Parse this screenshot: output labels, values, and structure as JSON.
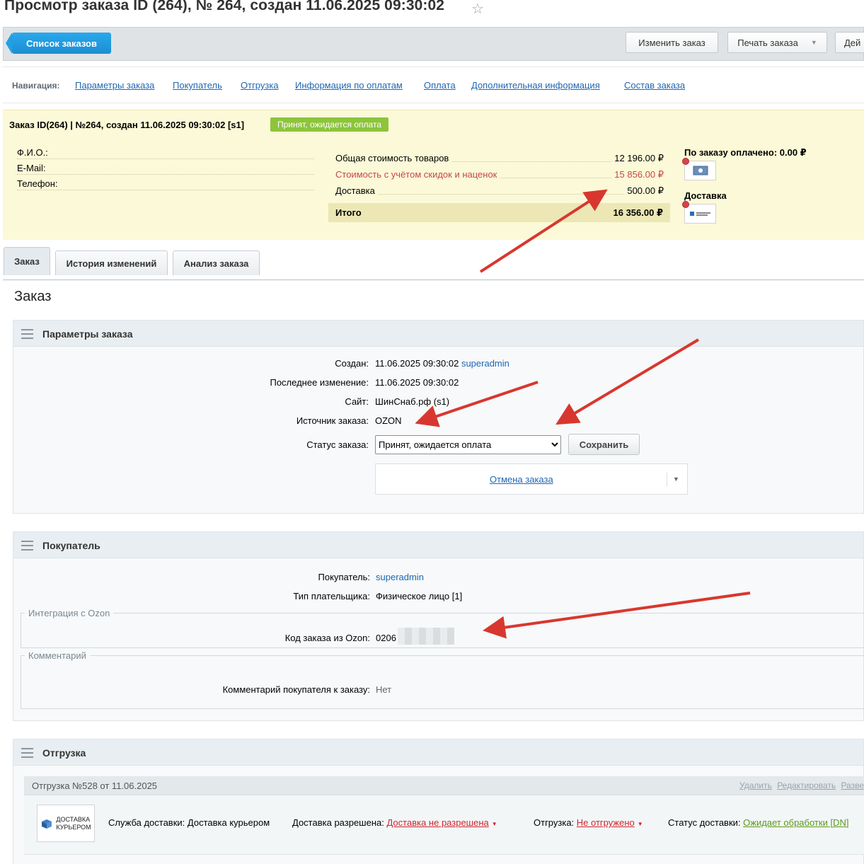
{
  "page": {
    "title": "Просмотр заказа ID (264), № 264, создан 11.06.2025 09:30:02"
  },
  "toolbar": {
    "back_label": "Список заказов",
    "edit_label": "Изменить заказ",
    "print_label": "Печать заказа",
    "actions_label": "Дей"
  },
  "nav": {
    "label": "Навигация:",
    "links": [
      "Параметры заказа",
      "Покупатель",
      "Отгрузка",
      "Информация по оплатам",
      "Оплата",
      "Дополнительная информация",
      "Состав заказа"
    ]
  },
  "summary": {
    "header": "Заказ ID(264) | №264, создан 11.06.2025 09:30:02 [s1]",
    "status": "Принят, ожидается оплата",
    "fio_label": "Ф.И.О.:",
    "email_label": "E-Mail:",
    "phone_label": "Телефон:",
    "goods_label": "Общая стоимость товаров",
    "goods_value": "12 196.00 ₽",
    "discount_label": "Стоимость с учётом скидок и наценок",
    "discount_value": "15 856.00 ₽",
    "delivery_label": "Доставка",
    "delivery_value": "500.00 ₽",
    "total_label": "Итого",
    "total_value": "16 356.00 ₽",
    "paid_label": "По заказу оплачено: 0.00 ₽",
    "delivery_title": "Доставка"
  },
  "tabs": [
    "Заказ",
    "История изменений",
    "Анализ заказа"
  ],
  "section_title": "Заказ",
  "order_params": {
    "title": "Параметры заказа",
    "created_label": "Создан:",
    "created_value": "11.06.2025 09:30:02",
    "created_user": "superadmin",
    "modified_label": "Последнее изменение:",
    "modified_value": "11.06.2025 09:30:02",
    "site_label": "Сайт:",
    "site_value": "ШинСнаб.рф (s1)",
    "source_label": "Источник заказа:",
    "source_value": "OZON",
    "status_label": "Статус заказа:",
    "status_value": "Принят, ожидается оплата",
    "save_label": "Сохранить",
    "cancel_label": "Отмена заказа"
  },
  "buyer": {
    "title": "Покупатель",
    "buyer_label": "Покупатель:",
    "buyer_value": "superadmin",
    "payer_label": "Тип плательщика:",
    "payer_value": "Физическое лицо [1]",
    "ozon_group": "Интеграция с Ozon",
    "ozon_code_label": "Код заказа из Ozon:",
    "ozon_code_value": "0206",
    "comment_group": "Комментарий",
    "comment_label": "Комментарий покупателя к заказу:",
    "comment_value": "Нет"
  },
  "shipment": {
    "block_title": "Отгрузка",
    "title": "Отгрузка №528 от 11.06.2025",
    "link_delete": "Удалить",
    "link_edit": "Редактировать",
    "link_more": "Разве",
    "logo_line1": "ДОСТАВКА",
    "logo_line2": "КУРЬЕРОМ",
    "service_label": "Служба доставки:",
    "service_value": "Доставка курьером",
    "allowed_label": "Доставка разрешена:",
    "allowed_value": "Доставка не разрешена",
    "shipped_label": "Отгрузка:",
    "shipped_value": "Не отгружено",
    "status_label": "Статус доставки:",
    "status_value": "Ожидает обработки [DN]"
  },
  "colors": {
    "accent": "#1c8ed1",
    "status_green": "#8dc43b",
    "annotation_red": "#d8372f",
    "highlight_yellow": "#fbf9d7"
  }
}
